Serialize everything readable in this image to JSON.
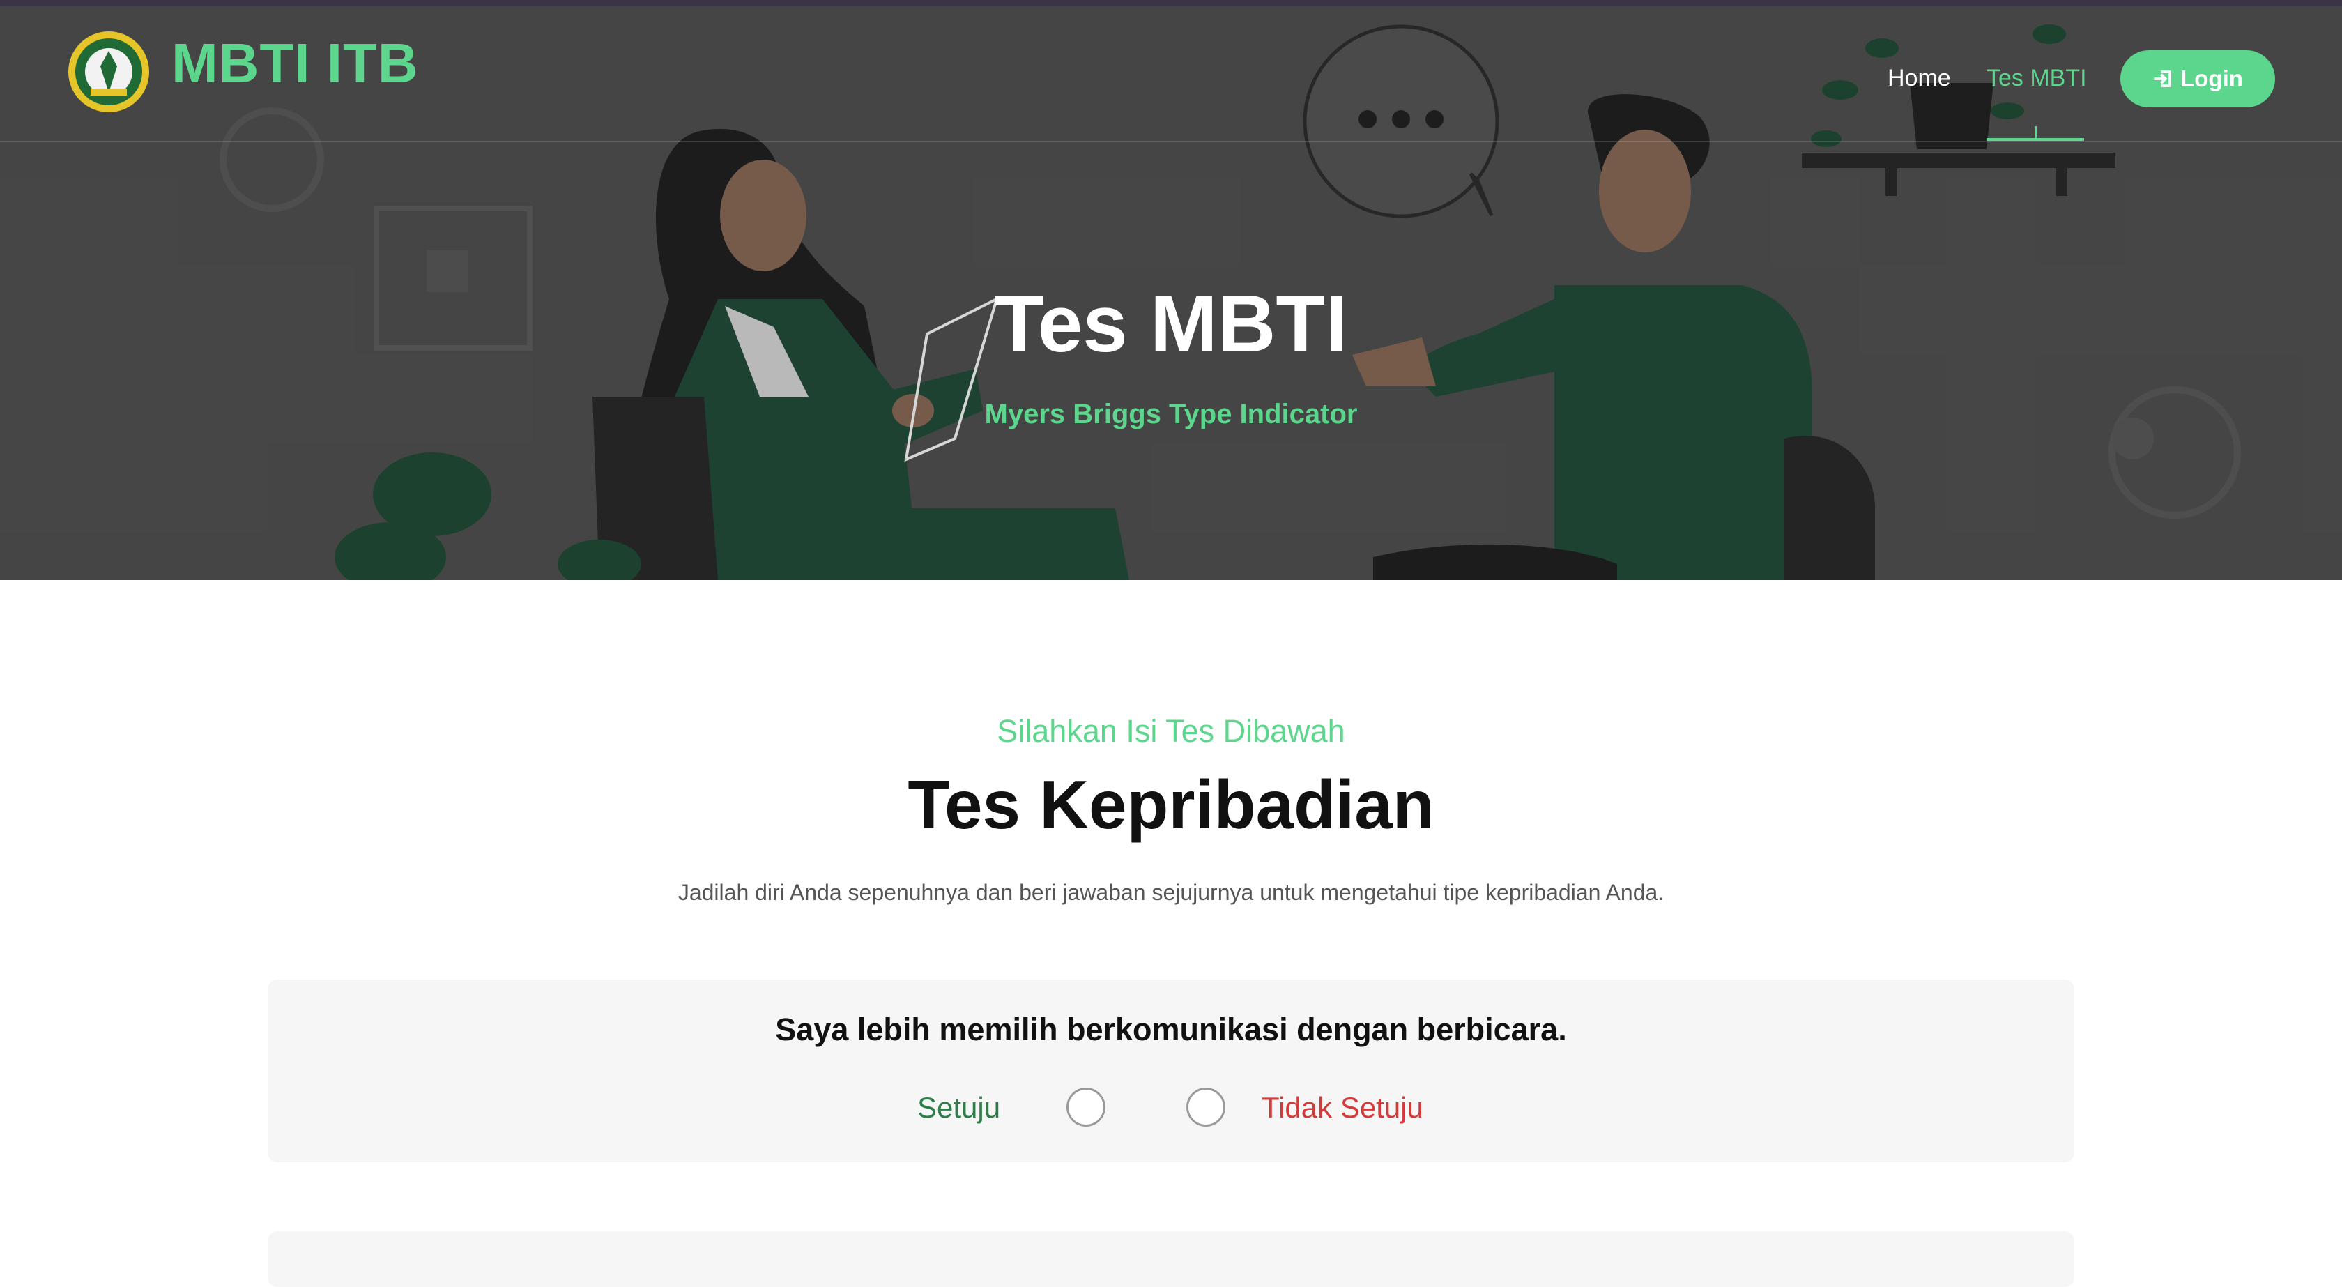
{
  "navbar": {
    "brand": "MBTI ITB",
    "logo_icon": "itb-yadika-seal-logo",
    "items": [
      {
        "label": "Home",
        "active": false
      },
      {
        "label": "Tes MBTI",
        "active": true
      }
    ],
    "login_label": "Login",
    "login_icon": "sign-in-icon"
  },
  "hero": {
    "title": "Tes MBTI",
    "subtitle": "Myers Briggs Type Indicator"
  },
  "section": {
    "kicker": "Silahkan Isi Tes Dibawah",
    "title": "Tes Kepribadian",
    "description": "Jadilah diri Anda sepenuhnya dan beri jawaban sejujurnya untuk mengetahui tipe kepribadian Anda."
  },
  "questions": [
    {
      "text": "Saya lebih memilih berkomunikasi dengan berbicara.",
      "agree_label": "Setuju",
      "disagree_label": "Tidak Setuju"
    }
  ],
  "colors": {
    "accent": "#5cd68c",
    "agree": "#2e7d4a",
    "disagree": "#d33a3a",
    "hero_bg": "#4e4e4e"
  }
}
